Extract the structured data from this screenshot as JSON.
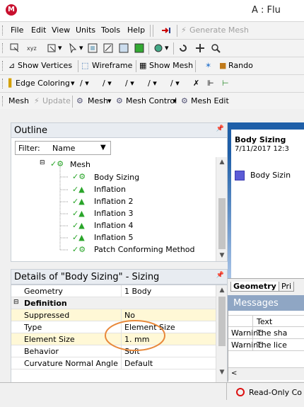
{
  "title": {
    "text": "A : Flu"
  },
  "menu": {
    "file": "File",
    "edit": "Edit",
    "view": "View",
    "units": "Units",
    "tools": "Tools",
    "help": "Help",
    "generate_mesh": "Generate Mesh"
  },
  "toolbar3": {
    "show_vertices": "Show Vertices",
    "wireframe": "Wireframe",
    "show_mesh": "Show Mesh",
    "random": "Rando"
  },
  "toolbar4": {
    "edge_coloring": "Edge Coloring"
  },
  "toolbar5": {
    "mesh": "Mesh",
    "update": "Update",
    "mesh_dd": "Mesh",
    "mesh_control": "Mesh Control",
    "mesh_edit": "Mesh Edit"
  },
  "outline": {
    "title": "Outline",
    "filter_label": "Filter:",
    "filter_value": "Name",
    "tree": [
      "Mesh",
      "Body Sizing",
      "Inflation",
      "Inflation 2",
      "Inflation 3",
      "Inflation 4",
      "Inflation 5",
      "Patch Conforming Method"
    ]
  },
  "details": {
    "title": "Details of \"Body Sizing\" - Sizing",
    "rows": [
      {
        "label": "Geometry",
        "value": "1 Body"
      },
      {
        "label": "Definition",
        "value": ""
      },
      {
        "label": "Suppressed",
        "value": "No"
      },
      {
        "label": "Type",
        "value": "Element Size"
      },
      {
        "label": "Element Size",
        "value": "1. mm"
      },
      {
        "label": "Behavior",
        "value": "Soft"
      },
      {
        "label": "Curvature Normal Angle",
        "value": "Default"
      }
    ]
  },
  "graphics": {
    "title": "Body Sizing",
    "date": "7/11/2017 12:3",
    "legend": "Body Sizin"
  },
  "tabs": {
    "geometry": "Geometry",
    "print": "Pri"
  },
  "messages": {
    "title": "Messages",
    "col_text": "Text",
    "rows": [
      {
        "type": "Warninc",
        "text": "The sha"
      },
      {
        "type": "Warninc",
        "text": "The lice"
      }
    ]
  },
  "status": {
    "read_only": "Read-Only Co"
  },
  "colors": {
    "accent_blue": "#1f5fa8",
    "highlight_circle": "#e8883a",
    "check_green": "#2aa52a"
  }
}
